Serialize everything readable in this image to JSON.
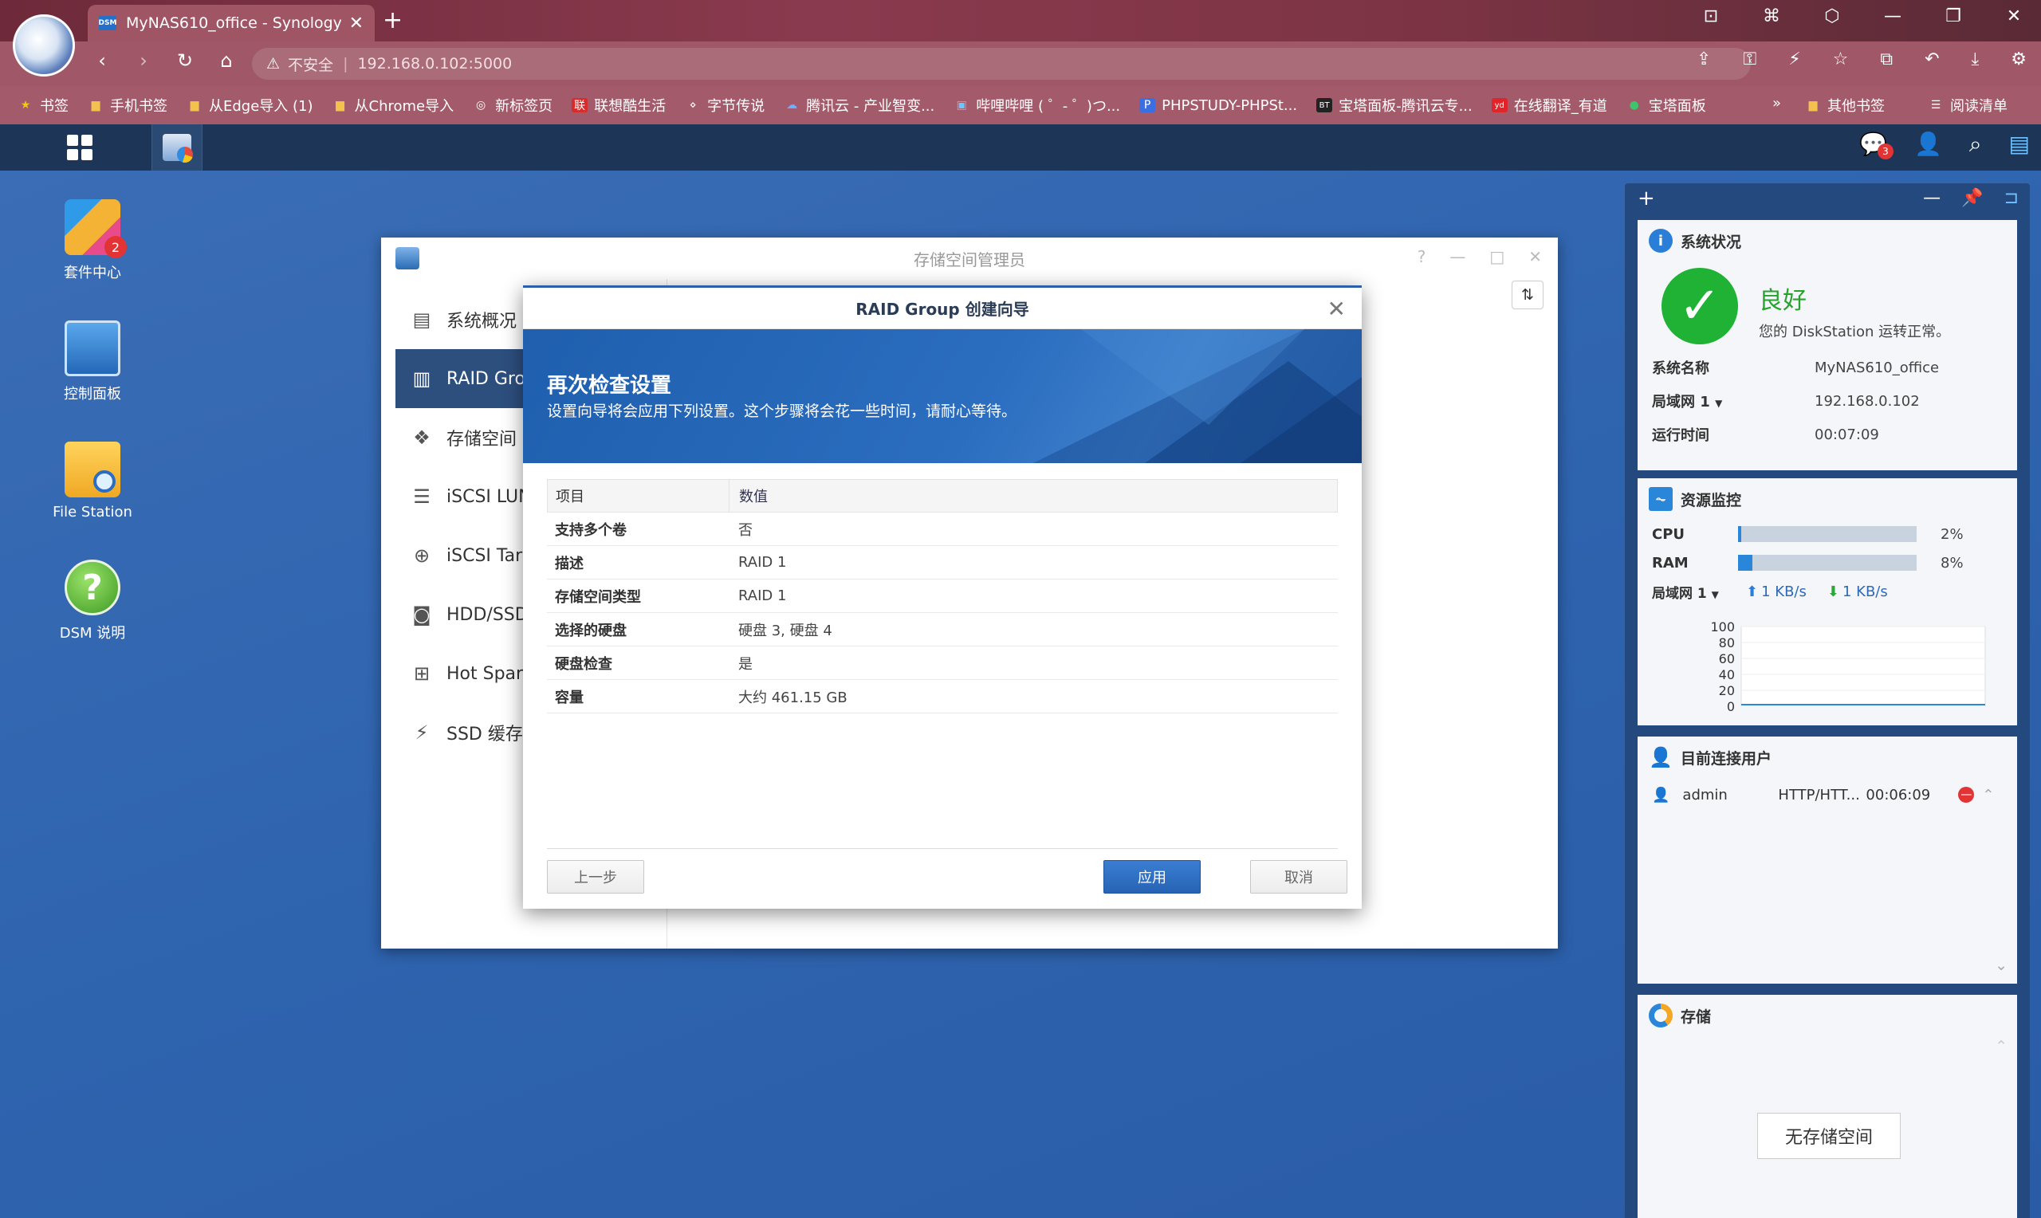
{
  "browser": {
    "tab_title": "MyNAS610_office - Synology D",
    "tab_favicon": "DSM",
    "insecure_label": "不安全",
    "url": "192.168.0.102:5000",
    "bookmarks": [
      {
        "label": "书签",
        "icon": "star-icon"
      },
      {
        "label": "手机书签",
        "icon": "folder-icon"
      },
      {
        "label": "从Edge导入 (1)",
        "icon": "folder-icon"
      },
      {
        "label": "从Chrome导入",
        "icon": "folder-icon"
      },
      {
        "label": "新标签页",
        "icon": "tab-icon"
      },
      {
        "label": "联想酷生活",
        "icon": "lenovo-icon"
      },
      {
        "label": "字节传说",
        "icon": "byte-icon"
      },
      {
        "label": "腾讯云 - 产业智变...",
        "icon": "cloud-icon"
      },
      {
        "label": "哔哩哔哩 ( ゜- ゜)つ...",
        "icon": "bilibili-icon"
      },
      {
        "label": "PHPSTUDY-PHPSt...",
        "icon": "p-icon"
      },
      {
        "label": "宝塔面板-腾讯云专...",
        "icon": "bt-icon"
      },
      {
        "label": "在线翻译_有道",
        "icon": "youdao-icon"
      },
      {
        "label": "宝塔面板",
        "icon": "leaf-icon"
      }
    ],
    "bookmarks_more": "»",
    "other_bookmarks": "其他书签",
    "reading_list": "阅读清单"
  },
  "taskbar": {
    "chat_badge": "3"
  },
  "desktop_icons": [
    {
      "label": "套件中心",
      "badge": "2"
    },
    {
      "label": "控制面板"
    },
    {
      "label": "File Station"
    },
    {
      "label": "DSM 说明"
    }
  ],
  "storage_manager": {
    "title": "存储空间管理员",
    "nav": [
      {
        "label": "系统概况",
        "icon": "overview-icon"
      },
      {
        "label": "RAID Grou",
        "icon": "raid-icon"
      },
      {
        "label": "存储空间",
        "icon": "cubes-icon"
      },
      {
        "label": "iSCSI LUN",
        "icon": "database-icon"
      },
      {
        "label": "iSCSI Targ",
        "icon": "globe-icon"
      },
      {
        "label": "HDD/SSD",
        "icon": "disk-icon"
      },
      {
        "label": "Hot Spare",
        "icon": "plus-box-icon"
      },
      {
        "label": "SSD 缓存",
        "icon": "flash-icon"
      }
    ]
  },
  "wizard": {
    "title": "RAID Group 创建向导",
    "heading": "再次检查设置",
    "subheading": "设置向导将会应用下列设置。这个步骤将会花一些时间，请耐心等待。",
    "col_item": "项目",
    "col_value": "数值",
    "rows": [
      {
        "k": "支持多个卷",
        "v": "否"
      },
      {
        "k": "描述",
        "v": "RAID 1"
      },
      {
        "k": "存储空间类型",
        "v": "RAID 1"
      },
      {
        "k": "选择的硬盘",
        "v": "硬盘 3, 硬盘 4"
      },
      {
        "k": "硬盘检查",
        "v": "是"
      },
      {
        "k": "容量",
        "v": "大约 461.15 GB"
      }
    ],
    "back": "上一步",
    "apply": "应用",
    "cancel": "取消"
  },
  "widgets": {
    "status": {
      "title": "系统状况",
      "state": "良好",
      "message": "您的 DiskStation 运转正常。",
      "fields": [
        {
          "k": "系统名称",
          "v": "MyNAS610_office"
        },
        {
          "k": "局域网 1",
          "v": "192.168.0.102"
        },
        {
          "k": "运行时间",
          "v": "00:07:09"
        }
      ]
    },
    "monitor": {
      "title": "资源监控",
      "cpu_label": "CPU",
      "cpu_pct": "2%",
      "cpu_value": 2,
      "ram_label": "RAM",
      "ram_pct": "8%",
      "ram_value": 8,
      "lan_label": "局域网 1",
      "up": "1 KB/s",
      "down": "1 KB/s",
      "y_ticks": [
        "100",
        "80",
        "60",
        "40",
        "20",
        "0"
      ]
    },
    "users": {
      "title": "目前连接用户",
      "user": "admin",
      "protocol": "HTTP/HTT...",
      "time": "00:06:09"
    },
    "storage": {
      "title": "存储",
      "empty": "无存储空间"
    }
  }
}
